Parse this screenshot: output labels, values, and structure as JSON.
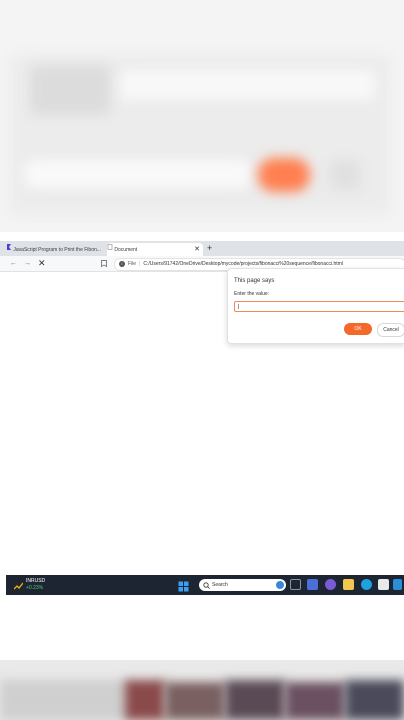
{
  "browser": {
    "tabs": [
      {
        "label": "JavaScript Program to Print the Fibon...",
        "active": false
      },
      {
        "label": "Document",
        "active": true
      }
    ],
    "new_tab": "+",
    "address": {
      "scheme_label": "File",
      "url": "C:/Users/91742/OneDrive/Desktop/mycode/projects/fibonacci%20sequence/fibonacci.html"
    }
  },
  "dialog": {
    "title": "This page says",
    "label": "Enter the value:",
    "input_value": "|",
    "ok_label": "OK",
    "cancel_label": "Cancel"
  },
  "taskbar": {
    "widget_symbol": "INRUSD",
    "widget_change": "+0.23%",
    "search_placeholder": "Search"
  },
  "colors": {
    "accent": "#f4692a",
    "taskbar": "#1d2533"
  }
}
